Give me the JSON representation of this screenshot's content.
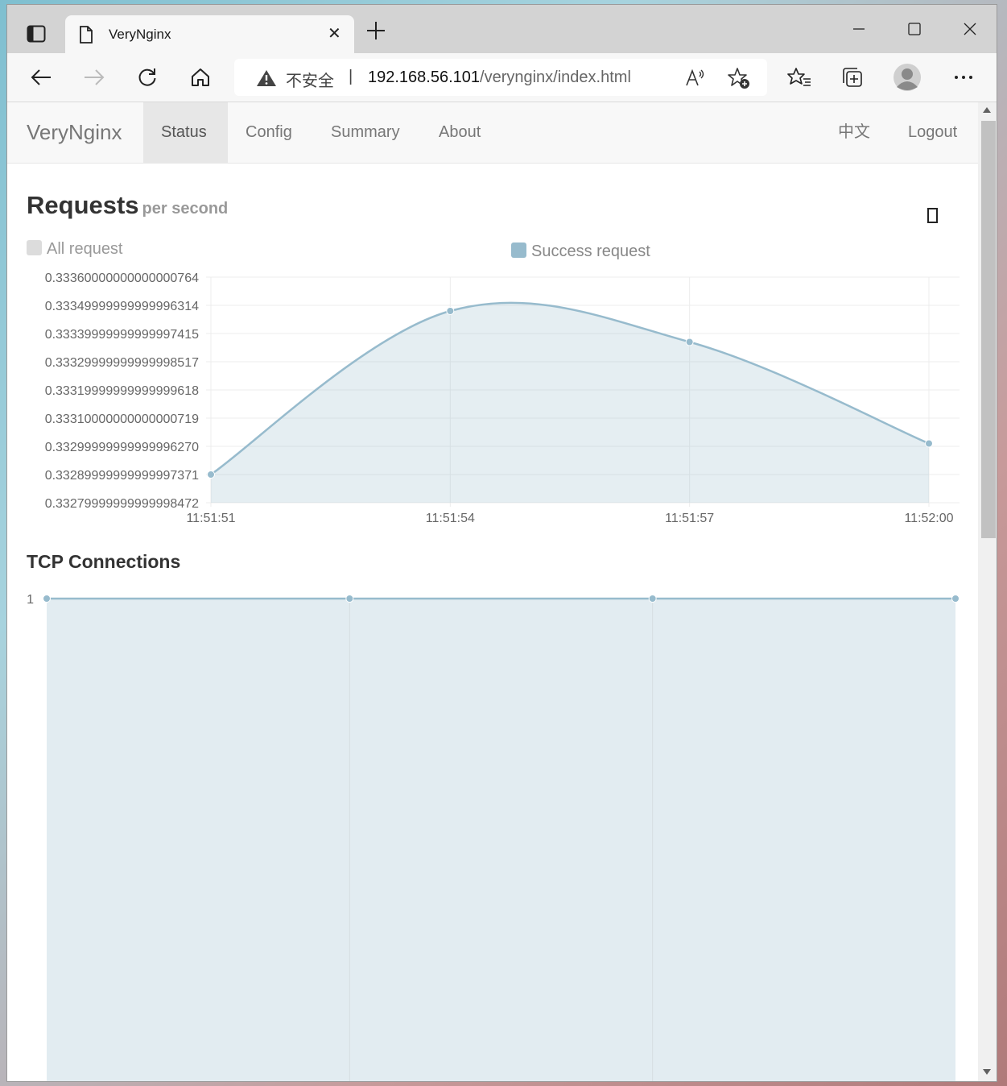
{
  "browser": {
    "tab_title": "VeryNginx",
    "insecure_label": "不安全",
    "separator": "|",
    "url_host": "192.168.56.101",
    "url_path": "/verynginx/index.html"
  },
  "navbar": {
    "brand": "VeryNginx",
    "items": [
      {
        "label": "Status",
        "active": true
      },
      {
        "label": "Config"
      },
      {
        "label": "Summary"
      },
      {
        "label": "About"
      }
    ],
    "lang_label": "中文",
    "logout_label": "Logout"
  },
  "requests": {
    "title": "Requests",
    "subtitle": "per second",
    "legend": [
      {
        "label": "All request",
        "color": "#dcdcdc"
      },
      {
        "label": "Success request",
        "color": "#97bbcd"
      }
    ]
  },
  "tcp": {
    "title": "TCP Connections"
  },
  "chart_data": [
    {
      "type": "line",
      "title": "Requests per second",
      "categories": [
        "11:51:51",
        "11:51:54",
        "11:51:57",
        "11:52:00"
      ],
      "series": [
        {
          "name": "Success request",
          "values": [
            0.3329,
            0.33348,
            0.33337,
            0.33301
          ],
          "color": "#97bbcd"
        }
      ],
      "yticks": [
        "0.33360000000000000764",
        "0.33349999999999996314",
        "0.33339999999999997415",
        "0.33329999999999998517",
        "0.33319999999999999618",
        "0.33310000000000000719",
        "0.33299999999999996270",
        "0.33289999999999997371",
        "0.33279999999999998472"
      ],
      "ylim": [
        0.3328,
        0.3336
      ],
      "grid": true,
      "legend_position": "top"
    },
    {
      "type": "area",
      "title": "TCP Connections",
      "series": [
        {
          "values": [
            1,
            1,
            1,
            1
          ],
          "color": "#97bbcd"
        }
      ],
      "yticks": [
        "1"
      ],
      "grid": true
    }
  ]
}
